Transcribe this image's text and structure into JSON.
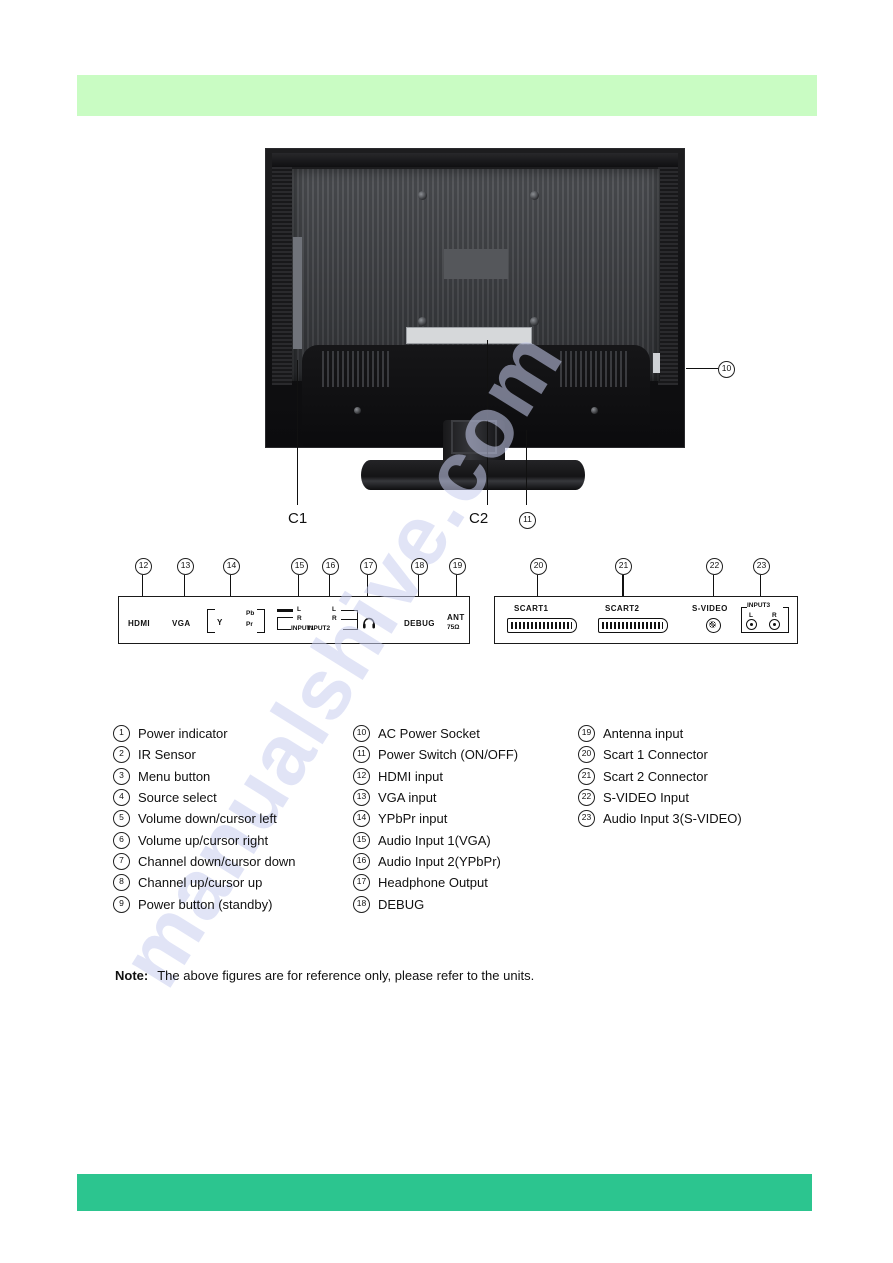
{
  "page": {
    "top_banner_color": "#c9fcc3",
    "bottom_banner_color": "#2cc58f",
    "watermark": "manualshive.com"
  },
  "figure": {
    "labels": {
      "c1": "C1",
      "c2": "C2",
      "callout_10": "10",
      "callout_11": "11"
    }
  },
  "panel_left": {
    "callouts": [
      "12",
      "13",
      "14",
      "15",
      "16",
      "17",
      "18",
      "19"
    ],
    "labels": {
      "hdmi": "HDMI",
      "vga": "VGA",
      "y": "Y",
      "pb": "Pb",
      "pr": "Pr",
      "in1_l": "L",
      "in1_r": "R",
      "in2_l": "L",
      "in2_r": "R",
      "input1": "INPUT1",
      "input2": "INPUT2",
      "headphone": "headphone-icon",
      "debug": "DEBUG",
      "ant": "ANT",
      "ant_ohm": "75Ω"
    }
  },
  "panel_right": {
    "callouts": [
      "20",
      "21",
      "22",
      "23"
    ],
    "labels": {
      "scart1": "SCART1",
      "scart2": "SCART2",
      "svideo": "S-VIDEO",
      "input3": "INPUT3",
      "in3_l": "L",
      "in3_r": "R"
    }
  },
  "legend": {
    "column1": [
      {
        "num": "1",
        "text": "Power indicator"
      },
      {
        "num": "2",
        "text": "IR Sensor"
      },
      {
        "num": "3",
        "text": "Menu button"
      },
      {
        "num": "4",
        "text": "Source select"
      },
      {
        "num": "5",
        "text": "Volume down/cursor left"
      },
      {
        "num": "6",
        "text": "Volume up/cursor right"
      },
      {
        "num": "7",
        "text": "Channel down/cursor down"
      },
      {
        "num": "8",
        "text": "Channel up/cursor up"
      },
      {
        "num": "9",
        "text": "Power button (standby)"
      }
    ],
    "column2": [
      {
        "num": "10",
        "text": "AC Power Socket"
      },
      {
        "num": "11",
        "text": "Power Switch (ON/OFF)"
      },
      {
        "num": "12",
        "text": "HDMI input"
      },
      {
        "num": "13",
        "text": "VGA input"
      },
      {
        "num": "14",
        "text": "YPbPr input"
      },
      {
        "num": "15",
        "text": "Audio Input 1(VGA)"
      },
      {
        "num": "16",
        "text": "Audio Input 2(YPbPr)"
      },
      {
        "num": "17",
        "text": "Headphone Output"
      },
      {
        "num": "18",
        "text": "DEBUG"
      }
    ],
    "column3": [
      {
        "num": "19",
        "text": "Antenna input"
      },
      {
        "num": "20",
        "text": "Scart 1 Connector"
      },
      {
        "num": "21",
        "text": "Scart 2 Connector"
      },
      {
        "num": "22",
        "text": "S-VIDEO Input"
      },
      {
        "num": "23",
        "text": "Audio Input 3(S-VIDEO)"
      }
    ]
  },
  "note": {
    "label": "Note:",
    "body": "The above figures are for reference only, please refer to the units."
  }
}
